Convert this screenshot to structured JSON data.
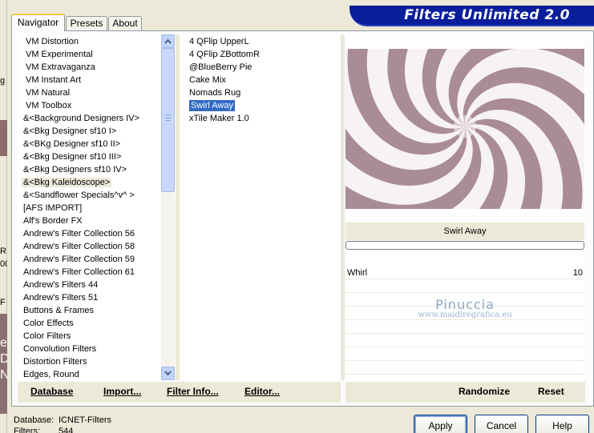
{
  "banner": {
    "title": "Filters Unlimited 2.0"
  },
  "tabs": [
    {
      "label": "Navigator"
    },
    {
      "label": "Presets"
    },
    {
      "label": "About"
    }
  ],
  "edge_fragments": [
    "g",
    "R",
    "00",
    "F",
    "e",
    "D",
    "N"
  ],
  "categories": [
    "VM Distortion",
    "VM Experimental",
    "VM Extravaganza",
    "VM Instant Art",
    "VM Natural",
    "VM Toolbox",
    "&<Background Designers IV>",
    "&<Bkg Designer sf10 I>",
    "&<BKg Designer sf10 II>",
    "&<Bkg Designer sf10 III>",
    "&<Bkg Designers sf10 IV>",
    "&<Bkg Kaleidoscope>",
    "&<Sandflower Specials^v^ >",
    "[AFS IMPORT]",
    "Alf's Border FX",
    "Andrew's Filter Collection 56",
    "Andrew's Filter Collection 58",
    "Andrew's Filter Collection 59",
    "Andrew's Filter Collection 61",
    "Andrew's Filters 44",
    "Andrew's Filters 51",
    "Buttons & Frames",
    "Color Effects",
    "Color Filters",
    "Convolution Filters",
    "Distortion Filters",
    "Edges, Round"
  ],
  "selected_category": "&<Bkg Kaleidoscope>",
  "filters": [
    "4 QFlip UpperL",
    "4 QFlip ZBottomR",
    "@BlueBerry Pie",
    "Cake Mix",
    "Nomads Rug",
    "Swirl Away",
    "xTile Maker 1.0"
  ],
  "selected_filter": "Swirl Away",
  "preview": {
    "colors": {
      "light": "#f7f2f4",
      "dark": "#8f6a77"
    }
  },
  "filter_name": "Swirl Away",
  "progress": 0,
  "params": [
    {
      "label": "Whirl",
      "value": "10"
    }
  ],
  "watermark": {
    "line1": "Pinuccia",
    "line2": "www.maidiregrafica.eu"
  },
  "bottom_links": {
    "database": "Database",
    "import": "Import...",
    "filter_info": "Filter Info...",
    "editor": "Editor...",
    "randomize": "Randomize",
    "reset": "Reset"
  },
  "status": {
    "database_label": "Database:",
    "database_value": "ICNET-Filters",
    "filters_label": "Filters:",
    "filters_value": "544"
  },
  "buttons": {
    "apply": "Apply",
    "cancel": "Cancel",
    "help": "Help"
  }
}
